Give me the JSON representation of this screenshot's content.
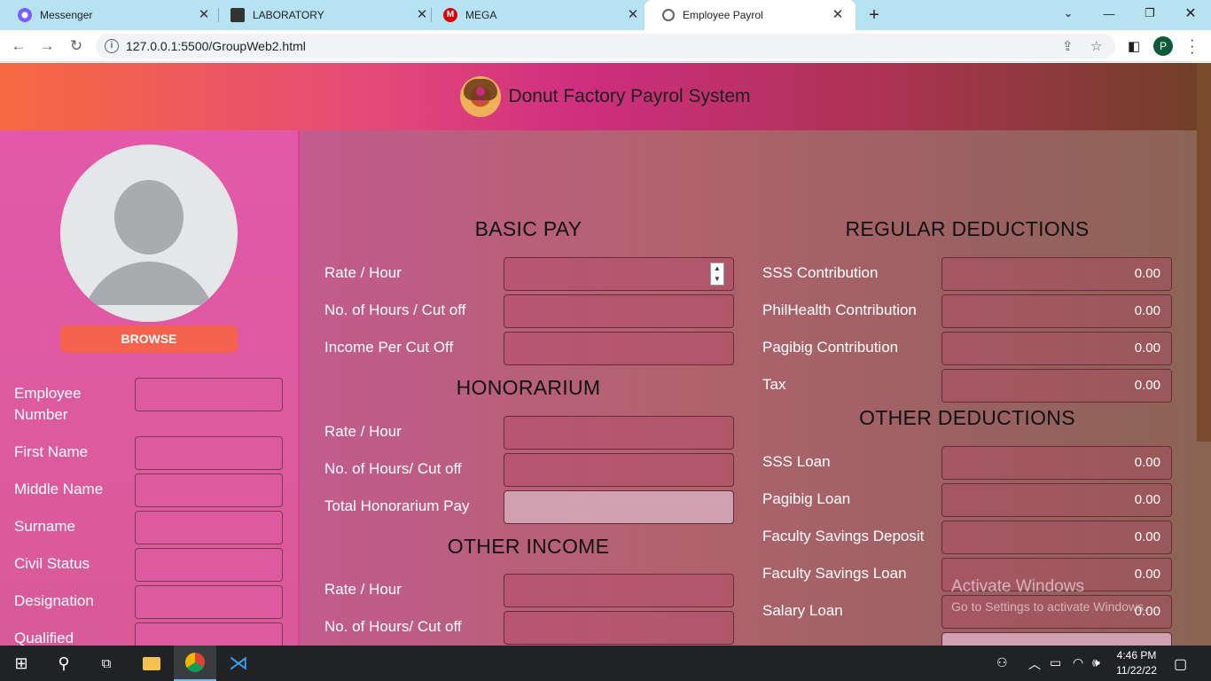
{
  "browser": {
    "tabs": [
      {
        "label": "Messenger",
        "icon": "messenger-icon"
      },
      {
        "label": "LABORATORY",
        "icon": "classroom-icon"
      },
      {
        "label": "MEGA",
        "icon": "mega-icon"
      },
      {
        "label": "Employee Payrol",
        "icon": "globe-icon",
        "active": true
      }
    ],
    "url": "127.0.0.1:5500/GroupWeb2.html",
    "profile_initial": "P"
  },
  "header": {
    "title": "Donut Factory Payrol System"
  },
  "sidebar": {
    "browse_label": "BROWSE",
    "fields": [
      {
        "label": "Employee Number"
      },
      {
        "label": "First Name"
      },
      {
        "label": "Middle Name"
      },
      {
        "label": "Surname"
      },
      {
        "label": "Civil Status"
      },
      {
        "label": "Designation"
      },
      {
        "label": "Qualified"
      }
    ]
  },
  "basic_pay": {
    "title": "BASIC PAY",
    "rate": "Rate / Hour",
    "hours": "No. of Hours / Cut off",
    "income": "Income Per Cut Off"
  },
  "honorarium": {
    "title": "HONORARIUM",
    "rate": "Rate / Hour",
    "hours": "No. of Hours/ Cut off",
    "total": "Total Honorarium Pay"
  },
  "other_income": {
    "title": "OTHER INCOME",
    "rate": "Rate / Hour",
    "hours": "No. of Hours/ Cut off"
  },
  "regular_deductions": {
    "title": "REGULAR DEDUCTIONS",
    "items": [
      {
        "label": "SSS Contribution",
        "value": "0.00"
      },
      {
        "label": "PhilHealth Contribution",
        "value": "0.00"
      },
      {
        "label": "Pagibig Contribution",
        "value": "0.00"
      },
      {
        "label": "Tax",
        "value": "0.00"
      }
    ]
  },
  "other_deductions": {
    "title": "OTHER DEDUCTIONS",
    "items": [
      {
        "label": "SSS Loan",
        "value": "0.00"
      },
      {
        "label": "Pagibig Loan",
        "value": "0.00"
      },
      {
        "label": "Faculty Savings Deposit",
        "value": "0.00"
      },
      {
        "label": "Faculty Savings Loan",
        "value": "0.00"
      },
      {
        "label": "Salary Loan",
        "value": "0.00"
      }
    ]
  },
  "watermark": {
    "line1": "Activate Windows",
    "line2": "Go to Settings to activate Windows."
  },
  "taskbar": {
    "time": "4:46 PM",
    "date": "11/22/22"
  }
}
